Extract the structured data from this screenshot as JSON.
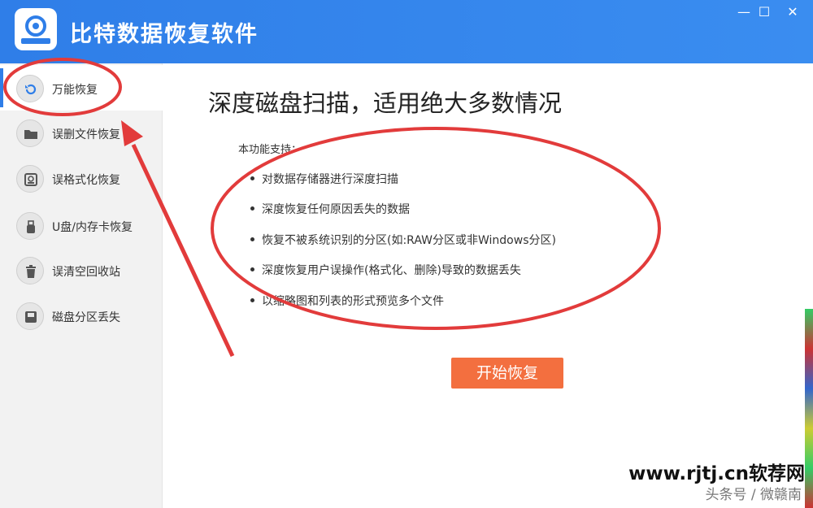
{
  "app": {
    "title": "比特数据恢复软件",
    "window_controls": {
      "minimize": "—",
      "maximize": "☐",
      "close": "✕"
    }
  },
  "sidebar": {
    "items": [
      {
        "label": "万能恢复",
        "icon": "undo-icon",
        "active": true
      },
      {
        "label": "误删文件恢复",
        "icon": "folder-icon",
        "active": false
      },
      {
        "label": "误格式化恢复",
        "icon": "disk-icon",
        "active": false
      },
      {
        "label": "U盘/内存卡恢复",
        "icon": "usb-icon",
        "active": false
      },
      {
        "label": "误清空回收站",
        "icon": "trash-icon",
        "active": false
      },
      {
        "label": "磁盘分区丢失",
        "icon": "drive-icon",
        "active": false
      }
    ]
  },
  "main": {
    "headline": "深度磁盘扫描，适用绝大多数情况",
    "intro": "本功能支持：",
    "features": [
      "对数据存储器进行深度扫描",
      "深度恢复任何原因丢失的数据",
      "恢复不被系统识别的分区(如:RAW分区或非Windows分区)",
      "深度恢复用户误操作(格式化、删除)导致的数据丢失",
      "以缩略图和列表的形式预览多个文件"
    ],
    "start_button": "开始恢复"
  },
  "watermark": {
    "url": "www.rjtj.cn软荐网",
    "source": "头条号 / 微赣南"
  },
  "colors": {
    "titlebar": "#2f7ee8",
    "accent": "#2f7ee8",
    "button": "#f36f3f",
    "annotation": "#e23b3b"
  }
}
